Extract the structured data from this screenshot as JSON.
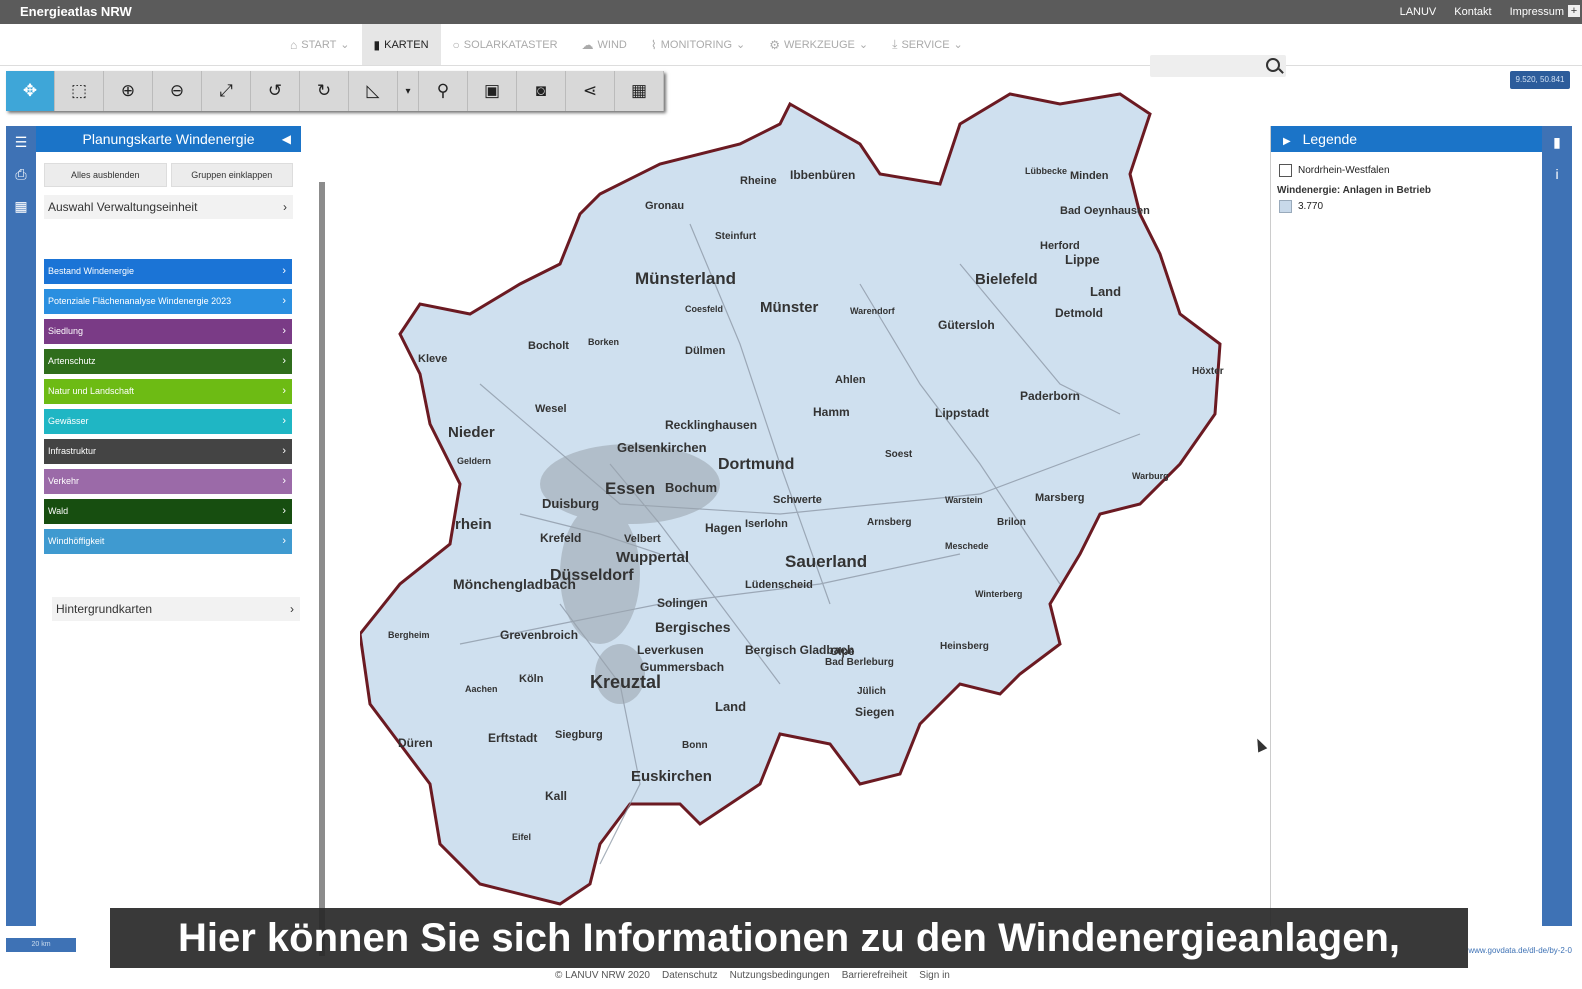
{
  "app": {
    "title": "Energieatlas NRW",
    "expand": "+"
  },
  "top_links": [
    "LANUV",
    "Kontakt",
    "Impressum"
  ],
  "nav": [
    {
      "label": "START",
      "icon": "home-icon",
      "glyph": "⌂",
      "dropdown": "⌄"
    },
    {
      "label": "KARTEN",
      "icon": "map-icon",
      "glyph": "▮",
      "active": true
    },
    {
      "label": "SOLARKATASTER",
      "icon": "sun-icon",
      "glyph": "○"
    },
    {
      "label": "WIND",
      "icon": "cloud-icon",
      "glyph": "☁"
    },
    {
      "label": "MONITORING",
      "icon": "chart-icon",
      "glyph": "⌇",
      "dropdown": "⌄"
    },
    {
      "label": "WERKZEUGE",
      "icon": "tools-icon",
      "glyph": "⚙",
      "dropdown": "⌄"
    },
    {
      "label": "SERVICE",
      "icon": "download-icon",
      "glyph": "⤓",
      "dropdown": "⌄"
    }
  ],
  "search": {
    "placeholder": ""
  },
  "toolbar": [
    {
      "name": "pan-tool",
      "glyph": "✥",
      "active": true
    },
    {
      "name": "zoom-box-tool",
      "glyph": "⬚"
    },
    {
      "name": "zoom-in-tool",
      "glyph": "⊕"
    },
    {
      "name": "zoom-out-tool",
      "glyph": "⊖"
    },
    {
      "name": "full-extent-tool",
      "glyph": "⤢"
    },
    {
      "name": "undo-tool",
      "glyph": "↺"
    },
    {
      "name": "redo-tool",
      "glyph": "↻"
    },
    {
      "name": "measure-tool",
      "glyph": "◺"
    },
    {
      "name": "measure-dropdown",
      "glyph": "▾"
    },
    {
      "name": "marker-tool",
      "glyph": "⚲"
    },
    {
      "name": "bookmark-tool",
      "glyph": "▣"
    },
    {
      "name": "screenshot-tool",
      "glyph": "◙"
    },
    {
      "name": "share-tool",
      "glyph": "⋖"
    },
    {
      "name": "calculator-tool",
      "glyph": "▦"
    }
  ],
  "coords": "9.520, 50.841",
  "left_rail": [
    {
      "name": "layers-icon",
      "glyph": "☰"
    },
    {
      "name": "print-icon",
      "glyph": "⎙"
    },
    {
      "name": "table-icon",
      "glyph": "▦"
    }
  ],
  "left_panel": {
    "title": "Planungskarte Windenergie",
    "collapse": "◀",
    "hide_all": "Alles ausblenden",
    "collapse_groups": "Gruppen einklappen",
    "admin_unit": "Auswahl Verwaltungseinheit",
    "background_maps": "Hintergrundkarten",
    "chevron": "›"
  },
  "layers": [
    {
      "label": "Bestand Windenergie",
      "color": "#1b74d6"
    },
    {
      "label": "Potenziale Flächenanalyse Windenergie 2023",
      "color": "#2a8fe0"
    },
    {
      "label": "Siedlung",
      "color": "#7a3b86"
    },
    {
      "label": "Artenschutz",
      "color": "#2f6d1c"
    },
    {
      "label": "Natur und Landschaft",
      "color": "#6dbb14"
    },
    {
      "label": "Gewässer",
      "color": "#1fb6c4"
    },
    {
      "label": "Infrastruktur",
      "color": "#444444"
    },
    {
      "label": "Verkehr",
      "color": "#9b6aa8"
    },
    {
      "label": "Wald",
      "color": "#174e10"
    },
    {
      "label": "Windhöffigkeit",
      "color": "#3f9ad0"
    }
  ],
  "legend": {
    "title": "Legende",
    "arrow": "▶",
    "info": "i",
    "map_icon": "▮",
    "item": "Nordrhein-Westfalen",
    "group": "Windenergie: Anlagen in Betrieb",
    "count": "3.770"
  },
  "map_labels": [
    "Rheine",
    "Ibbenbüren",
    "Gronau",
    "Steinfurt",
    "Lübbecke",
    "Minden",
    "Bad Oeynhausen",
    "Herford",
    "Bielefeld",
    "Lippe",
    "Land",
    "Münster",
    "Münsterland",
    "Coesfeld",
    "Warendorf",
    "Gütersloh",
    "Detmold",
    "Bocholt",
    "Borken",
    "Dülmen",
    "Ahlen",
    "Kleve",
    "Wesel",
    "Hamm",
    "Lippstadt",
    "Paderborn",
    "Höxter",
    "Nieder",
    "Recklinghausen",
    "Gelsenkirchen",
    "Dortmund",
    "Geldern",
    "Soest",
    "Essen",
    "Bochum",
    "Duisburg",
    "Schwerte",
    "Warstein",
    "Marsberg",
    "Warburg",
    "rhein",
    "Krefeld",
    "Velbert",
    "Hagen",
    "Iserlohn",
    "Arnsberg",
    "Brilon",
    "Wuppertal",
    "Sauerland",
    "Meschede",
    "Mönchengladbach",
    "Düsseldorf",
    "Lüdenscheid",
    "Winterberg",
    "Solingen",
    "Grevenbroich",
    "Bergisches",
    "Leverkusen",
    "Bergisch Gladbach",
    "Gummersbach",
    "Olpe",
    "Bad Berleburg",
    "Heinsberg",
    "Bergheim",
    "Köln",
    "Kreuztal",
    "Jülich",
    "Land",
    "Siegen",
    "Aachen",
    "Düren",
    "Erftstadt",
    "Siegburg",
    "Bonn",
    "Euskirchen",
    "Kall",
    "Eifel"
  ],
  "scale": "20 km",
  "license": "www.govdata.de/dl-de/by-2-0",
  "footer": [
    "© LANUV NRW 2020",
    "Datenschutz",
    "Nutzungsbedingungen",
    "Barrierefreiheit",
    "Sign in"
  ],
  "subtitle": "Hier können Sie sich Informationen zu den Windenergieanlagen,"
}
